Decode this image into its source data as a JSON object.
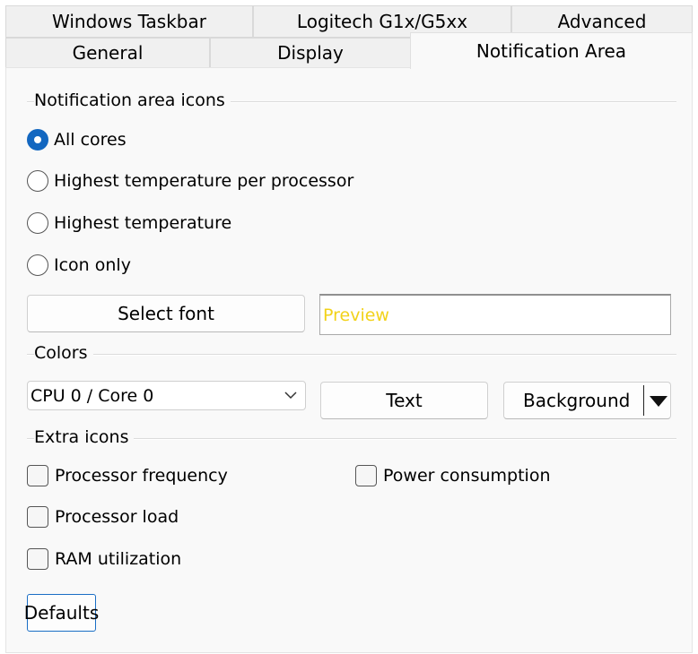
{
  "tabs": {
    "row1": [
      "Windows Taskbar",
      "Logitech G1x/G5xx",
      "Advanced"
    ],
    "row2": [
      "General",
      "Display",
      "Notification Area"
    ],
    "active": "Notification Area"
  },
  "notification_icons": {
    "title": "Notification area icons",
    "options": [
      "All cores",
      "Highest temperature per processor",
      "Highest temperature",
      "Icon only"
    ],
    "selected": "All cores"
  },
  "font": {
    "select_font_label": "Select font",
    "preview_text": "Preview",
    "preview_color": "#f2d21a"
  },
  "colors": {
    "title": "Colors",
    "core_select_value": "CPU 0 / Core 0",
    "text_button": "Text",
    "background_button": "Background"
  },
  "extra_icons": {
    "title": "Extra icons",
    "processor_frequency": "Processor frequency",
    "power_consumption": "Power consumption",
    "processor_load": "Processor load",
    "ram_utilization": "RAM utilization"
  },
  "defaults_label": "Defaults",
  "accent": "#1367c0"
}
